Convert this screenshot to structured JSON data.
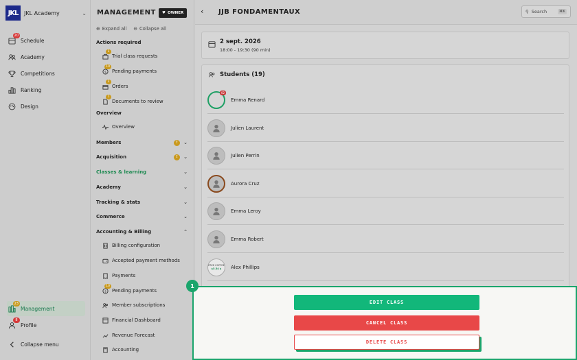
{
  "brand": {
    "logo": "JKL",
    "name": "JKL Academy"
  },
  "leftnav": {
    "items": [
      {
        "label": "Schedule",
        "icon": "calendar-icon",
        "badge": "20"
      },
      {
        "label": "Academy",
        "icon": "users-icon",
        "badge": ""
      },
      {
        "label": "Competitions",
        "icon": "trophy-icon",
        "badge": ""
      },
      {
        "label": "Ranking",
        "icon": "ranking-icon",
        "badge": ""
      },
      {
        "label": "Design",
        "icon": "palette-icon",
        "badge": ""
      }
    ],
    "bottom": [
      {
        "label": "Management",
        "icon": "management-icon",
        "badge": "23"
      },
      {
        "label": "Profile",
        "icon": "profile-icon",
        "badge": "8"
      },
      {
        "label": "Collapse menu",
        "icon": "chevron-left-icon",
        "badge": ""
      }
    ]
  },
  "management": {
    "title": "MANAGEMENT",
    "owner": "OWNER",
    "expand_all": "Expand all",
    "collapse_all": "Collapse all",
    "actions_required": "Actions required",
    "actions": [
      {
        "label": "Trial class requests",
        "badge": "1"
      },
      {
        "label": "Pending payments",
        "badge": "10"
      },
      {
        "label": "Orders",
        "badge": "2"
      },
      {
        "label": "Documents to review",
        "badge": "1"
      }
    ],
    "overview_label": "Overview",
    "overview_item": "Overview",
    "groups": [
      {
        "label": "Members",
        "dot": "!"
      },
      {
        "label": "Acquisition",
        "dot": "!"
      },
      {
        "label": "Classes & learning",
        "dot": ""
      },
      {
        "label": "Academy",
        "dot": ""
      },
      {
        "label": "Tracking & stats",
        "dot": ""
      },
      {
        "label": "Commerce",
        "dot": ""
      },
      {
        "label": "Accounting & Billing",
        "dot": ""
      }
    ],
    "billing_items": [
      {
        "label": "Billing configuration",
        "badge": ""
      },
      {
        "label": "Accepted payment methods",
        "badge": ""
      },
      {
        "label": "Payments",
        "badge": ""
      },
      {
        "label": "Pending payments",
        "badge": "10"
      },
      {
        "label": "Member subscriptions",
        "badge": ""
      },
      {
        "label": "Financial Dashboard",
        "badge": ""
      },
      {
        "label": "Revenue Forecast",
        "badge": ""
      },
      {
        "label": "Accounting",
        "badge": ""
      }
    ]
  },
  "content": {
    "title": "JJB FONDAMENTAUX",
    "search_label": "Search",
    "search_kbd": "⌘K",
    "date": "2 sept. 2026",
    "time": "18:00 - 19:30 (90 min)",
    "students_title": "Students (19)",
    "students": [
      {
        "name": "Emma Renard"
      },
      {
        "name": "Julien Laurent"
      },
      {
        "name": "Julien Perrin"
      },
      {
        "name": "Aurora Cruz"
      },
      {
        "name": "Emma Leroy"
      },
      {
        "name": "Emma Robert"
      },
      {
        "name": "Alex Phillips"
      }
    ],
    "avatar_badge": "02",
    "qr_text_1": "FREE COFFEE",
    "qr_text_2": "$5.54 $"
  },
  "sheet": {
    "step": "1",
    "edit": "EDIT CLASS",
    "cancel": "CANCEL CLASS",
    "delete": "DELETE CLASS"
  }
}
